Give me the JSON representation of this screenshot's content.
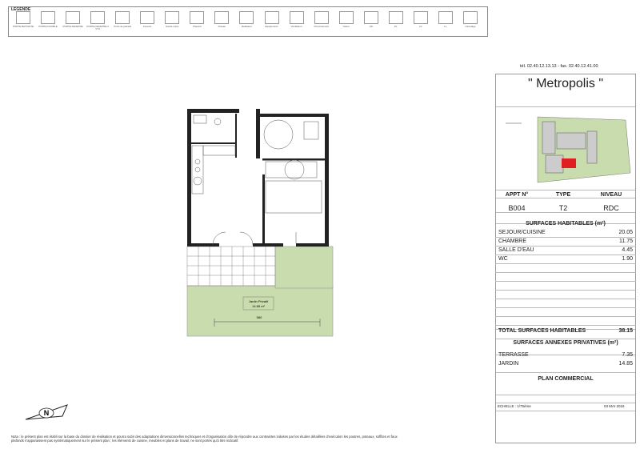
{
  "legend": {
    "title": "LEGENDE",
    "items": [
      "PORTE BATTANTE",
      "PORTE DOUBLE",
      "PORTE FENETRE",
      "PORTE FENETRE 2 VTX",
      "Porte de placard",
      "Fenetre",
      "Garde corps",
      "Placard",
      "Poteau",
      "Radiateur",
      "Equipement",
      "Ventilation",
      "Cheminement",
      "Gaine",
      "VR",
      "PL",
      "LV",
      "LL",
      "Carrelage"
    ]
  },
  "contact": {
    "text": "tél. 02.40.12.13.13 - fax. 02.40.12.41.00"
  },
  "project": {
    "name": "\" Metropolis \""
  },
  "apartment": {
    "headers": [
      "APPT N°",
      "TYPE",
      "NIVEAU"
    ],
    "values": [
      "B004",
      "T2",
      "RDC"
    ]
  },
  "surfaces_habitables": {
    "title": "SURFACES HABITABLES (m²)",
    "rows": [
      {
        "label": "SEJOUR/CUISINE",
        "value": "20.05"
      },
      {
        "label": "CHAMBRE",
        "value": "11.75"
      },
      {
        "label": "SALLE D'EAU",
        "value": "4.45"
      },
      {
        "label": "WC",
        "value": "1.90"
      }
    ],
    "total_label": "TOTAL SURFACES HABITABLES",
    "total_value": "38.15"
  },
  "surfaces_annexes": {
    "title": "SURFACES ANNEXES PRIVATIVES (m²)",
    "rows": [
      {
        "label": "TERRASSE",
        "value": "7.35"
      },
      {
        "label": "JARDIN",
        "value": "14.85"
      }
    ]
  },
  "plan_type": "PLAN COMMERCIAL",
  "scale": {
    "label": "ECHELLE : 1/75ème",
    "date": "03 MAI 2016"
  },
  "garden_label": "Jardin Privatif",
  "garden_area": "14.85 m²",
  "dimension_label": "580",
  "note": "Nota : le présent plan est établi sur la base du dossier de réalisation et pourra subir des adaptations dimensionnelles techniques et d'organisation afin de répondre aux contraintes induites par les études détaillées d'exécution les poutres, poteaux, soffites et faux plafonds n'apparaissent pas systématiquement sur le présent plan ; les éléments de cuisine, meubles et plans de travail, ne sont portés qu'à titre indicatif.",
  "colors": {
    "garden": "#c8dcae",
    "terrace_tile": "#888888",
    "wall": "#222222",
    "highlight": "#e02020"
  }
}
